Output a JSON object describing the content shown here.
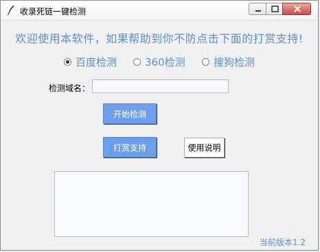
{
  "window": {
    "title": "收录死链一键检测",
    "controls": {
      "minimize": "minimize",
      "maximize": "maximize",
      "close": "close"
    }
  },
  "welcome_text": "欢迎使用本软件，如果帮助到你不防点击下面的打赏支持!",
  "engines": [
    {
      "label": "百度检测",
      "selected": true
    },
    {
      "label": "360检测",
      "selected": false
    },
    {
      "label": "搜狗检测",
      "selected": false
    }
  ],
  "domain": {
    "label": "检测域名：",
    "value": ""
  },
  "buttons": {
    "start": "开始检测",
    "support": "打赏支持",
    "help": "使用说明"
  },
  "result": {
    "value": ""
  },
  "version": "当前版本1.2",
  "colors": {
    "accent": "#5b8fd6",
    "button": "#6d9eeb"
  },
  "icons": {
    "app": "quill-pen-icon"
  }
}
